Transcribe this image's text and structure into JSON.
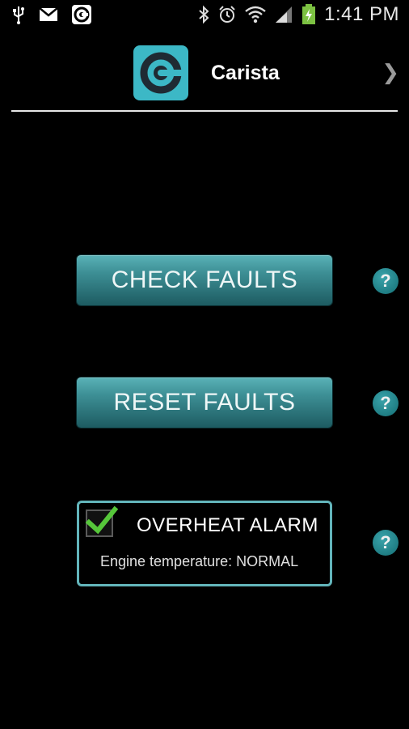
{
  "status_bar": {
    "time": "1:41 PM",
    "icons_left": [
      "usb-icon",
      "gmail-icon",
      "carista-notification-icon"
    ],
    "icons_right": [
      "bluetooth-icon",
      "alarm-icon",
      "wifi-icon",
      "signal-icon",
      "battery-charging-icon"
    ]
  },
  "header": {
    "app_name": "Carista",
    "chevron": "❯",
    "accent_color": "#3cb8c6"
  },
  "actions": {
    "check_faults_label": "CHECK FAULTS",
    "reset_faults_label": "RESET FAULTS",
    "help_glyph": "?"
  },
  "alarm": {
    "title": "OVERHEAT ALARM",
    "checked": true,
    "status_text": "Engine temperature: NORMAL",
    "border_color": "#63b5bb",
    "check_color": "#56c63a"
  }
}
